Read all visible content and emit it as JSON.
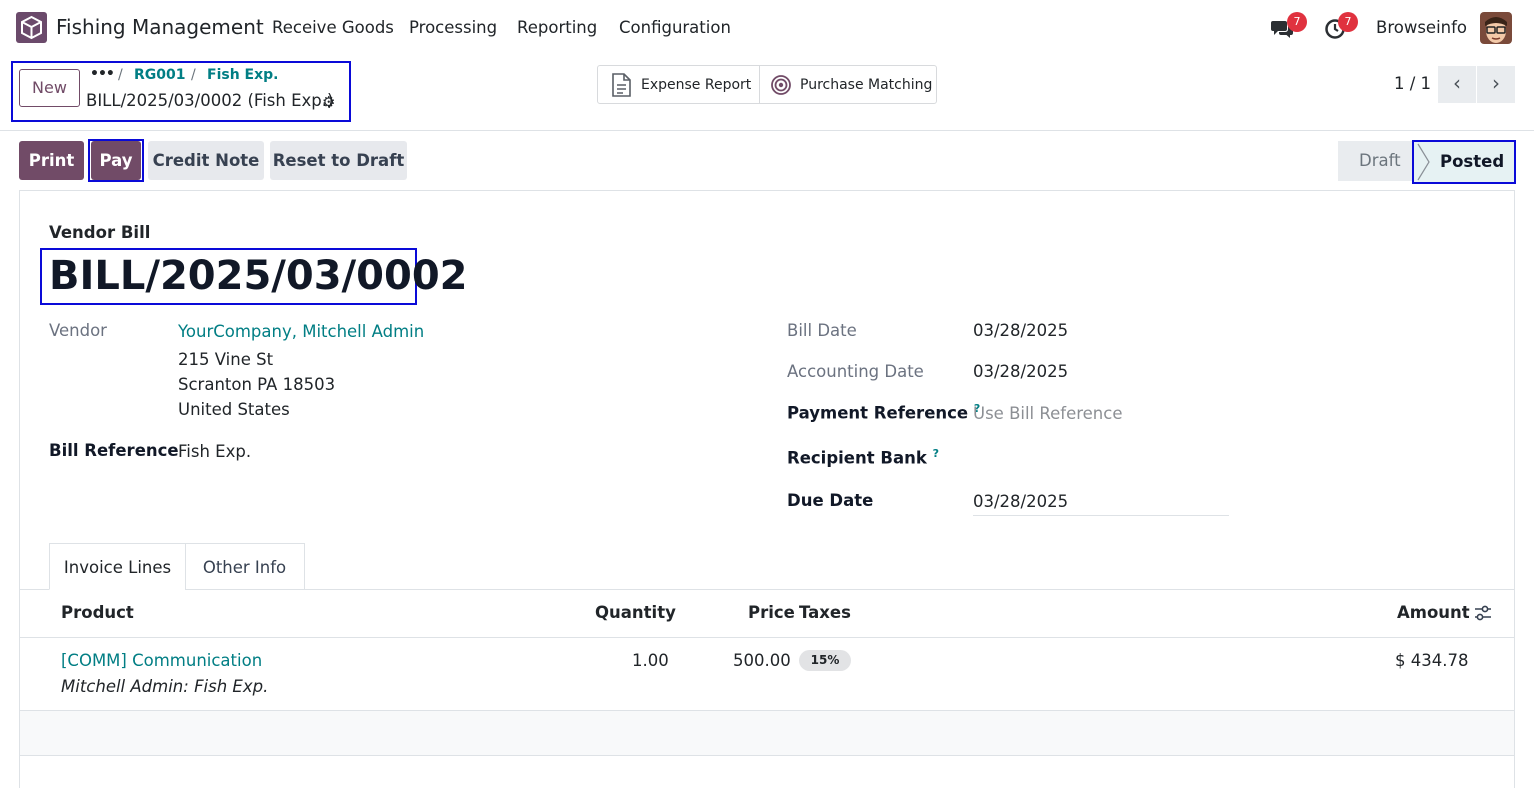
{
  "navbar": {
    "app_name": "Fishing Management",
    "menu": [
      "Receive Goods",
      "Processing",
      "Reporting",
      "Configuration"
    ],
    "messages_count": "7",
    "activities_count": "7",
    "user_name": "Browseinfo"
  },
  "control_panel": {
    "new_label": "New",
    "breadcrumbs": [
      "RG001",
      "Fish Exp."
    ],
    "record_name": "BILL/2025/03/0002 (Fish Exp.)",
    "smart_buttons": [
      "Expense Report",
      "Purchase Matching"
    ],
    "pager": "1 / 1"
  },
  "actions": {
    "print": "Print",
    "pay": "Pay",
    "credit_note": "Credit Note",
    "reset_to_draft": "Reset to Draft"
  },
  "status": {
    "draft": "Draft",
    "posted": "Posted"
  },
  "bill": {
    "doc_type": "Vendor Bill",
    "number": "BILL/2025/03/0002",
    "vendor_label": "Vendor",
    "vendor_name": "YourCompany, Mitchell Admin",
    "vendor_address": [
      "215 Vine St",
      "Scranton PA 18503",
      "United States"
    ],
    "bill_reference_label": "Bill Reference",
    "bill_reference": "Fish Exp.",
    "bill_date_label": "Bill Date",
    "bill_date": "03/28/2025",
    "accounting_date_label": "Accounting Date",
    "accounting_date": "03/28/2025",
    "payment_reference_label": "Payment Reference",
    "payment_reference_placeholder": "Use Bill Reference",
    "recipient_bank_label": "Recipient Bank",
    "due_date_label": "Due Date",
    "due_date": "03/28/2025",
    "help_mark": "?"
  },
  "tabs": [
    "Invoice Lines",
    "Other Info"
  ],
  "lines": {
    "headers": {
      "product": "Product",
      "quantity": "Quantity",
      "price": "Price",
      "taxes": "Taxes",
      "amount": "Amount"
    },
    "rows": [
      {
        "product": "[COMM] Communication",
        "description": "Mitchell Admin: Fish Exp.",
        "quantity": "1.00",
        "price": "500.00",
        "tax": "15%",
        "amount": "$ 434.78"
      }
    ]
  }
}
